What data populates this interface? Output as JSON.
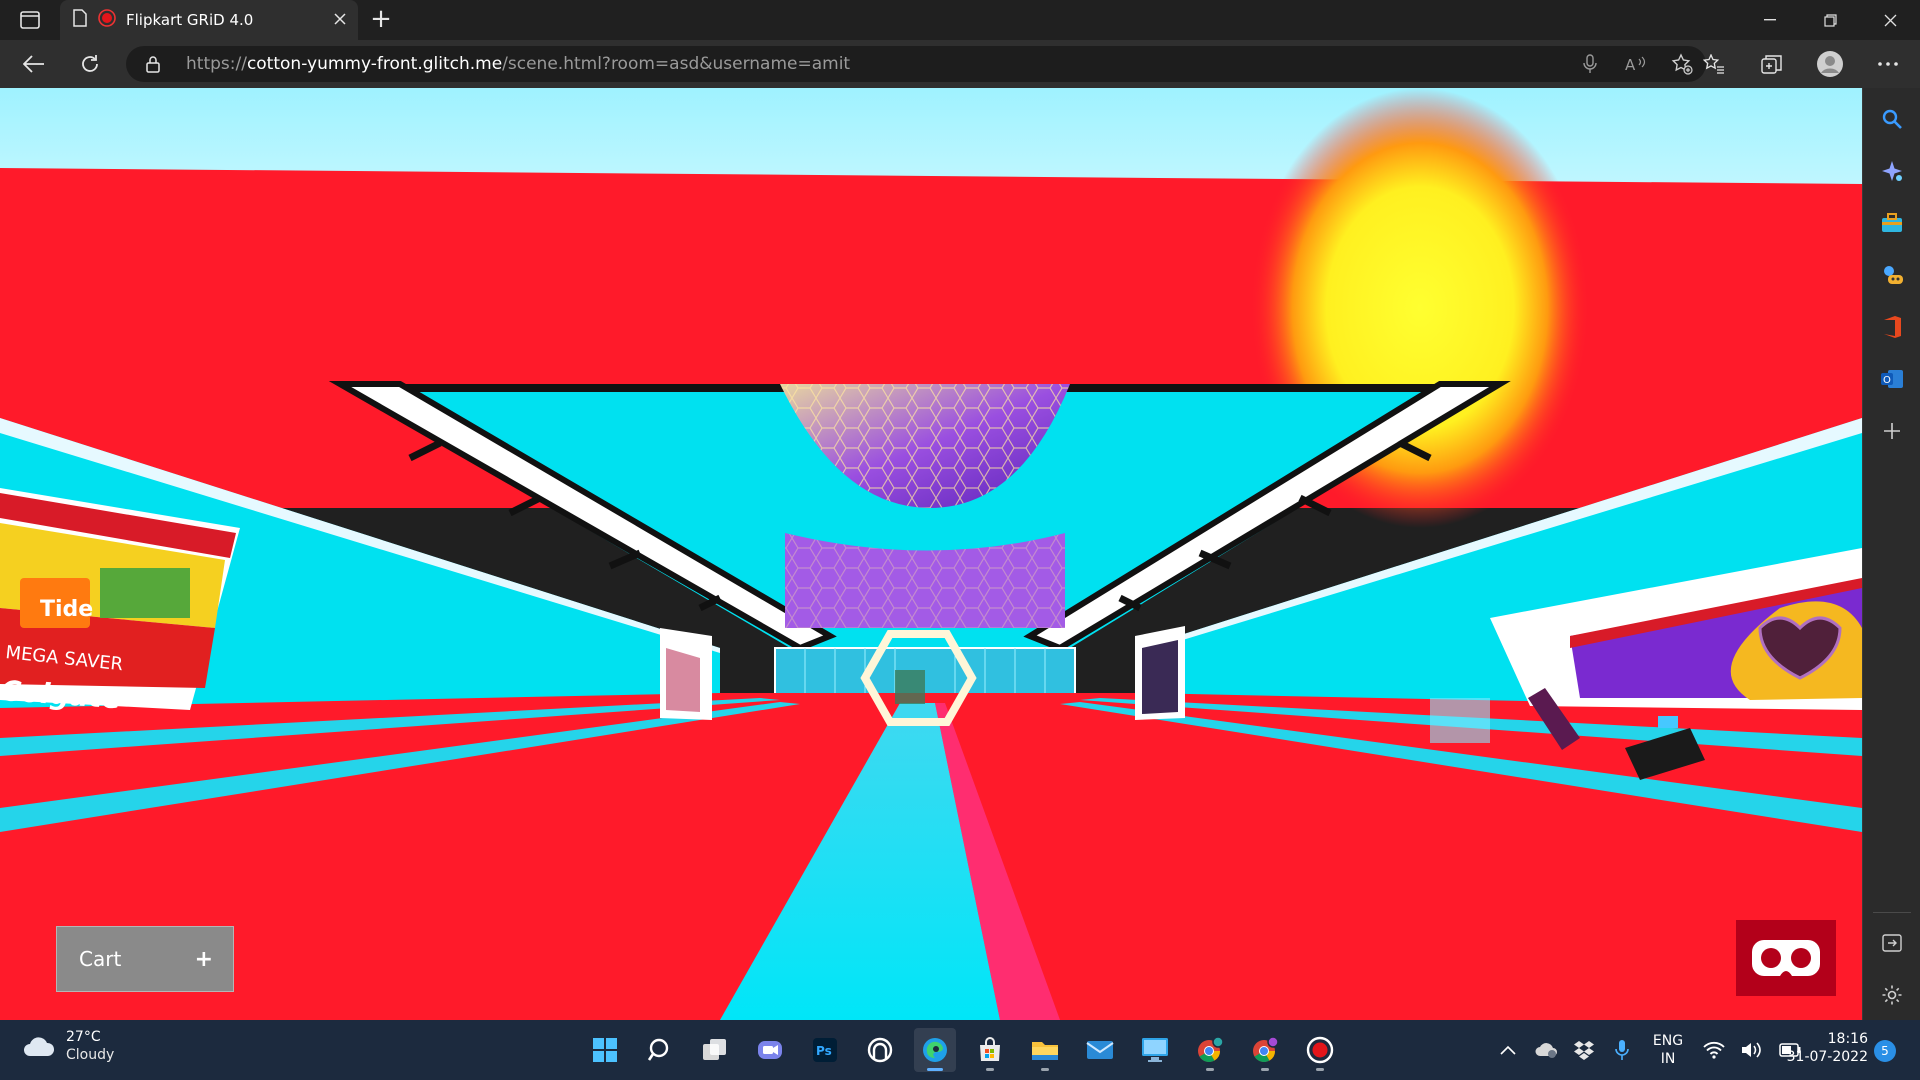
{
  "browser": {
    "tab_title": "Flipkart GRiD 4.0",
    "url_prefix": "https://",
    "url_host": "cotton-yummy-front.glitch.me",
    "url_path": "/scene.html?room=asd&username=amit"
  },
  "scene": {
    "billboard_left_text1": "MEGA SAVER",
    "billboard_left_text2": "Colgate",
    "billboard_left_text3": "Tide"
  },
  "page": {
    "cart_label": "Cart",
    "cart_plus": "+"
  },
  "taskbar": {
    "weather_temp": "27°C",
    "weather_cond": "Cloudy",
    "lang_top": "ENG",
    "lang_bottom": "IN",
    "time": "18:16",
    "date": "31-07-2022",
    "notification_count": "5"
  },
  "colors": {
    "accent_red": "#ff1a2a",
    "accent_cyan": "#00e1f0",
    "vr_button": "#b3001a",
    "taskbar": "#1c2a3e"
  }
}
